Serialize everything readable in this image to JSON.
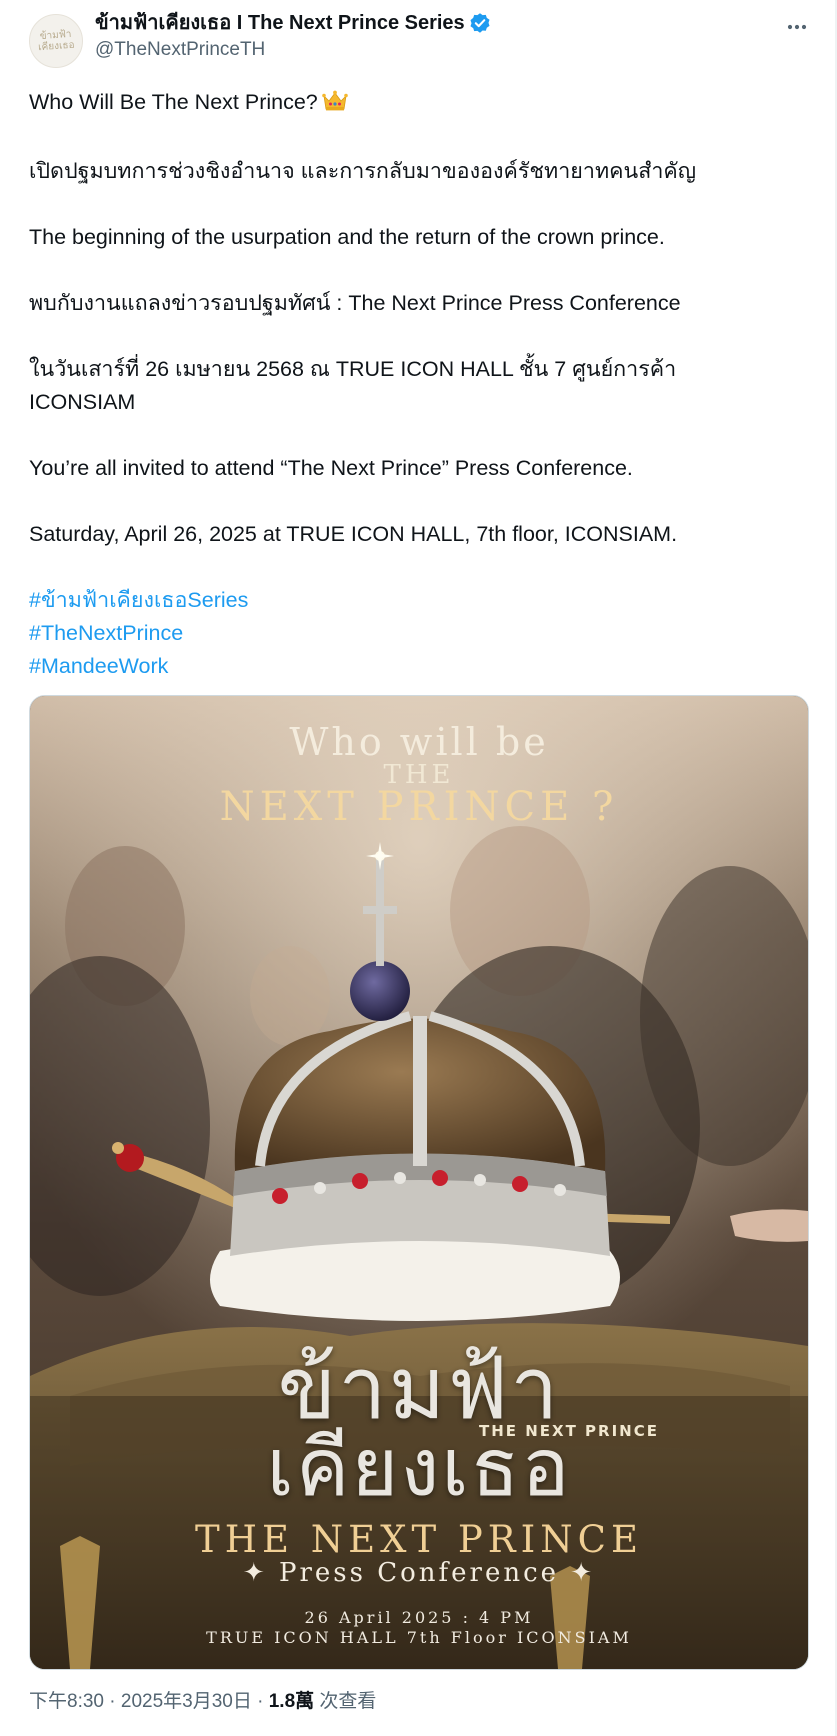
{
  "account": {
    "display_name": "ข้ามฟ้าเคียงเธอ I The Next Prince Series",
    "handle": "@TheNextPrinceTH",
    "avatar_text": "ข้ามฟ้า เคียงเธอ",
    "verified": true
  },
  "post": {
    "lines": [
      "Who Will Be The Next Prince?",
      "เปิดปฐมบทการช่วงชิงอำนาจ และการกลับมาขององค์รัชทายาทคนสำคัญ",
      "The beginning of the usurpation and the return of the crown prince.",
      "พบกับงานแถลงข่าวรอบปฐมทัศน์ : The Next Prince Press Conference",
      "ในวันเสาร์ที่ 26 เมษายน 2568 ณ TRUE ICON HALL ชั้น 7 ศูนย์การค้า",
      "ICONSIAM",
      "You’re all invited to attend “The Next Prince” Press Conference.",
      "Saturday, April 26, 2025 at TRUE ICON HALL, 7th floor, ICONSIAM."
    ],
    "hashtags": [
      "#ข้ามฟ้าเคียงเธอSeries",
      "#TheNextPrince",
      "#MandeeWork"
    ],
    "emoji": "crown-icon"
  },
  "poster": {
    "who": "Who will be",
    "the": "THE",
    "next": "NEXT PRINCE ?",
    "thai_line1": "ข้ามฟ้า",
    "thai_line2": "เคียงเธอ",
    "small_logo": "THE NEXT PRINCE",
    "title": "THE NEXT PRINCE",
    "press": "✦ Press Conference ✦",
    "date": "26 April 2025 : 4 PM",
    "venue": "TRUE ICON HALL 7th Floor ICONSIAM"
  },
  "footer": {
    "time": "下午8:30",
    "sep1": " · ",
    "date": "2025年3月30日",
    "sep2": " · ",
    "views_count": "1.8萬",
    "views_label": " 次查看"
  },
  "colors": {
    "link": "#1d9bf0",
    "secondary_text": "#536471",
    "verified_badge": "#1d9bf0",
    "poster_gold": "#f0cf95"
  }
}
